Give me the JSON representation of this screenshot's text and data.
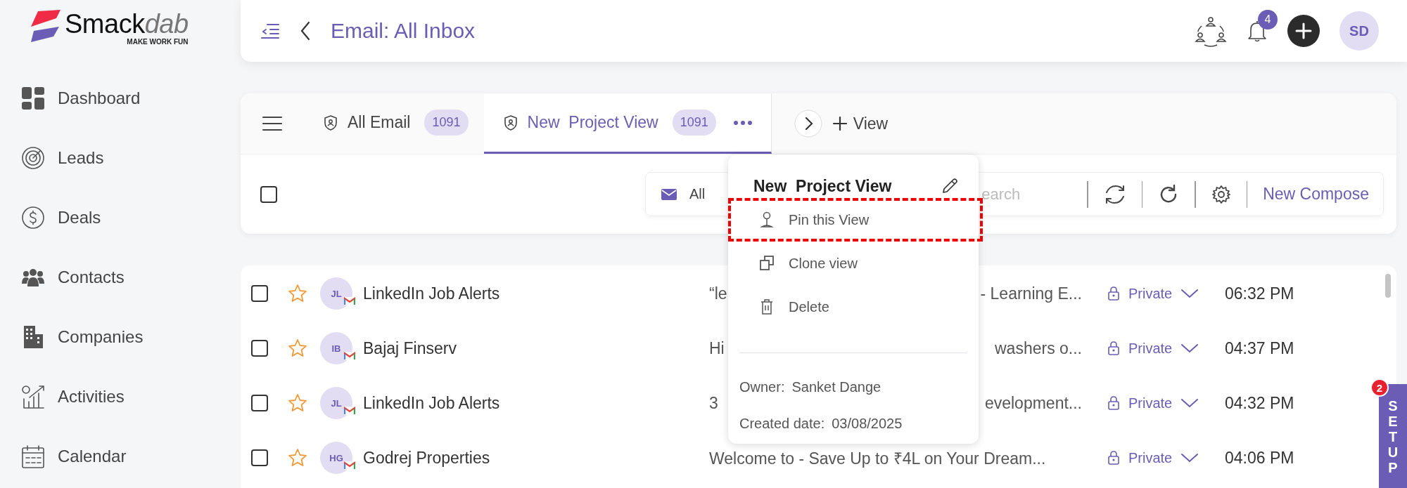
{
  "logo": {
    "name_main": "Smack",
    "name_light": "dab",
    "tagline": "MAKE WORK FUN"
  },
  "sidebar": {
    "items": [
      {
        "label": "Dashboard",
        "selected": false
      },
      {
        "label": "Leads",
        "selected": false
      },
      {
        "label": "Deals",
        "selected": false
      },
      {
        "label": "Contacts",
        "selected": false
      },
      {
        "label": "Companies",
        "selected": false
      },
      {
        "label": "Activities",
        "selected": false
      },
      {
        "label": "Calendar",
        "selected": false
      }
    ]
  },
  "header": {
    "title": "Email: All Inbox",
    "notification_count": "4",
    "avatar": "SD"
  },
  "tabs": [
    {
      "label": "All Email",
      "count": "1091",
      "selected": false
    },
    {
      "label": "New  Project View",
      "count": "1091",
      "selected": true
    }
  ],
  "add_view": "View",
  "toolbar": {
    "select_all_checked": false,
    "filter": "All",
    "search_placeholder": "earch",
    "compose": "New Compose"
  },
  "view_menu": {
    "title": "New  Project View",
    "items": [
      {
        "label": "Pin this View",
        "kind": "pin",
        "highlighted": true
      },
      {
        "label": "Clone view",
        "kind": "clone",
        "highlighted": false
      },
      {
        "label": "Delete",
        "kind": "delete",
        "highlighted": false
      }
    ],
    "owner_label": "Owner:",
    "owner": "Sanket Dange",
    "created_label": "Created date:",
    "created_date": "03/08/2025"
  },
  "emails": [
    {
      "initials": "JL",
      "sender": "LinkedIn Job Alerts",
      "subject_start": "“le",
      "subject_end": "- Learning E...",
      "visibility": "Private",
      "time": "06:32 PM",
      "starred": false,
      "checked": false
    },
    {
      "initials": "IB",
      "sender": "Bajaj Finserv",
      "subject_start": "Hi",
      "subject_end": "washers o...",
      "visibility": "Private",
      "time": "04:37 PM",
      "starred": false,
      "checked": false
    },
    {
      "initials": "JL",
      "sender": "LinkedIn Job Alerts",
      "subject_start": "3",
      "subject_end": "evelopment...",
      "visibility": "Private",
      "time": "04:32 PM",
      "starred": false,
      "checked": false
    },
    {
      "initials": "HG",
      "sender": "Godrej Properties",
      "subject_start": "Welcome to - Save Up to ₹4L on Your Dream...",
      "visibility": "Private",
      "time": "04:06 PM",
      "starred": false,
      "checked": false
    }
  ],
  "setup": {
    "label": "SETUP",
    "badge": "2"
  }
}
